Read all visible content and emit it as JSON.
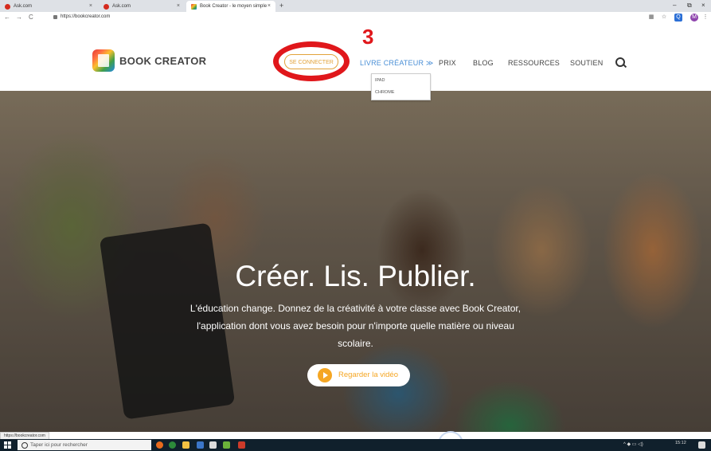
{
  "browser": {
    "tabs": [
      {
        "label": "Ask.com",
        "active": false
      },
      {
        "label": "Ask.com",
        "active": false
      },
      {
        "label": "Book Creator - le moyen simple",
        "active": true
      }
    ],
    "new_tab": "+",
    "url": "https://bookcreator.com",
    "window_controls": [
      "–",
      "⧉",
      "×"
    ],
    "nav": {
      "back": "←",
      "forward": "→",
      "reload": "C"
    },
    "extensions": {
      "star": "☆",
      "q": "Q",
      "avatar": "M",
      "menu": "⋮"
    }
  },
  "site": {
    "brand": "BOOK CREATOR",
    "signin": "SE CONNECTER",
    "step_marker": "3",
    "nav": {
      "livre": "LIVRE CRÉATEUR ≫",
      "prix": "PRIX",
      "blog": "BLOG",
      "ressources": "RESSOURCES",
      "soutien": "SOUTIEN"
    },
    "dropdown": [
      "IPAD",
      "CHROME"
    ]
  },
  "hero": {
    "headline": "Créer. Lis. Publier.",
    "sub_lines": [
      "L'éducation change. Donnez de la créativité à votre classe avec Book Creator,",
      "l'application dont vous avez besoin pour n'importe quelle matière ou niveau",
      "scolaire."
    ],
    "watch_label": "Regarder la vidéo"
  },
  "status_url": "https://bookcreator.com",
  "taskbar": {
    "search_placeholder": "Taper ici pour rechercher",
    "time": "15:12",
    "tray": "^ ◆ ▭ ◁)"
  },
  "colors": {
    "accent_orange": "#f5a623",
    "nav_blue": "#4a8fd6",
    "annotation_red": "#e0171b"
  }
}
